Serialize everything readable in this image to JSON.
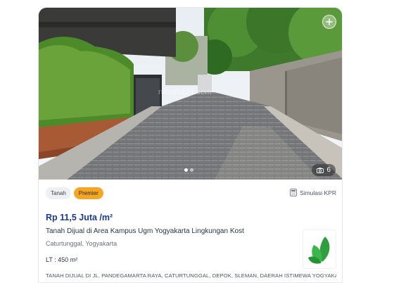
{
  "listing": {
    "photo": {
      "watermark": "rumah123.com",
      "carousel": {
        "total_dots": 2,
        "active_index": 0
      },
      "photo_count": "6"
    },
    "tags": [
      "Tanah",
      "Premier"
    ],
    "kpr_label": "Simulasi KPR",
    "price": "Rp 11,5 Juta /m²",
    "title": "Tanah Dijual di Area Kampus Ugm Yogyakarta Lingkungan Kost",
    "location": "Caturtunggal, Yogyakarta",
    "area": "LT : 450 m²",
    "address": "TANAH DIJUAL DI JL. PANDEGAMARTA RAYA, CATURTUNGGAL, DEPOK, SLEMAN, DAERAH ISTIMEWA YOGYAKARTA"
  },
  "colors": {
    "price": "#1d3a8a",
    "premier_badge": "#f5a623",
    "logo_green": "#2e9e3f"
  },
  "icons": {
    "favorite": "plus-circle-icon",
    "photo_count": "camera-icon",
    "kpr": "calculator-icon",
    "agency_logo": "green-leaf-logo"
  }
}
